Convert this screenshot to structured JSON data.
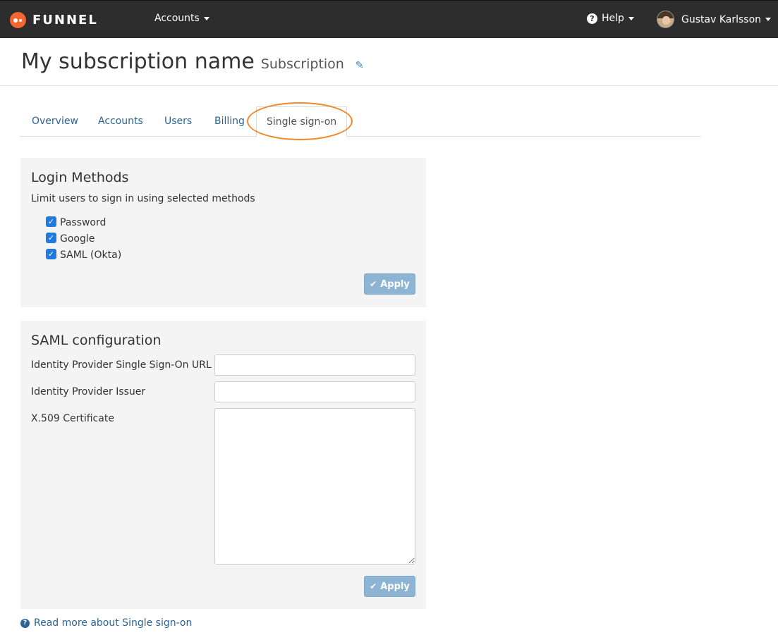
{
  "topbar": {
    "brand": "FUNNEL",
    "accounts_label": "Accounts",
    "help_label": "Help",
    "user_name": "Gustav Karlsson"
  },
  "header": {
    "title": "My subscription name",
    "subtitle": "Subscription"
  },
  "tabs": [
    {
      "label": "Overview"
    },
    {
      "label": "Accounts"
    },
    {
      "label": "Users"
    },
    {
      "label": "Billing"
    },
    {
      "label": "Single sign-on",
      "active": true
    }
  ],
  "login_methods": {
    "heading": "Login Methods",
    "help": "Limit users to sign in using selected methods",
    "options": [
      {
        "label": "Password",
        "checked": true
      },
      {
        "label": "Google",
        "checked": true
      },
      {
        "label": "SAML (Okta)",
        "checked": true
      }
    ],
    "apply_label": "Apply"
  },
  "saml": {
    "heading": "SAML configuration",
    "sso_url_label": "Identity Provider Single Sign-On URL",
    "sso_url_value": "",
    "issuer_label": "Identity Provider Issuer",
    "issuer_value": "",
    "certificate_label": "X.509 Certificate",
    "certificate_value": "",
    "apply_label": "Apply"
  },
  "footer": {
    "read_more": "Read more about Single sign-on"
  },
  "colors": {
    "topbar": "#2d2d2d",
    "brand_orange": "#f26631",
    "link": "#2a6496",
    "highlight": "#f0892b",
    "apply_button": "#8db4d2",
    "checkbox": "#1f7ae0"
  }
}
